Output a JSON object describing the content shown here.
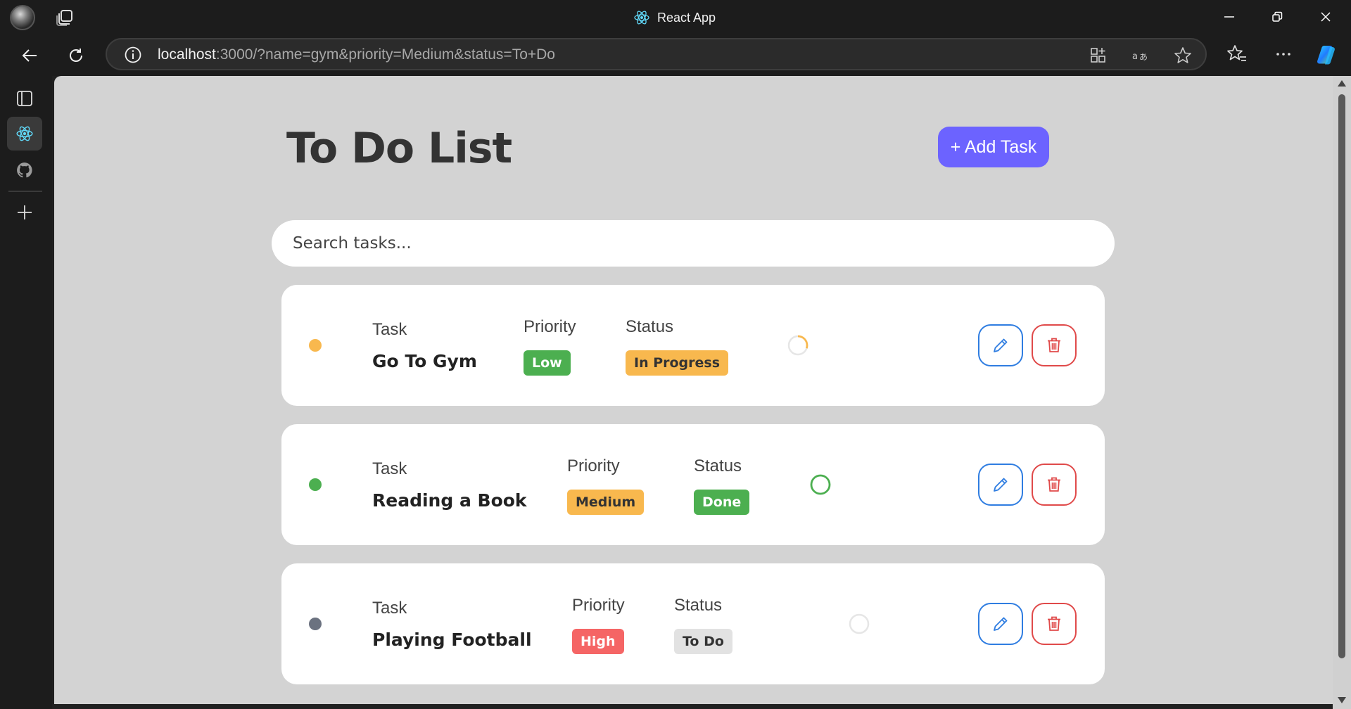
{
  "window": {
    "title": "React App"
  },
  "toolbar": {
    "url_host": "localhost",
    "url_rest": ":3000/?name=gym&priority=Medium&status=To+Do"
  },
  "app": {
    "title": "To Do List",
    "add_button": "+ Add Task",
    "search_placeholder": "Search tasks...",
    "column_labels": {
      "task": "Task",
      "priority": "Priority",
      "status": "Status"
    },
    "tasks": [
      {
        "name": "Go To Gym",
        "priority": "Low",
        "status": "In Progress",
        "dot_color": "#f8b84e",
        "priority_color": "#4caf50",
        "status_color": "#f8b84e",
        "progress_fraction": 0.3
      },
      {
        "name": "Reading a Book",
        "priority": "Medium",
        "status": "Done",
        "dot_color": "#4caf50",
        "priority_color": "#f8b84e",
        "status_color": "#4caf50",
        "progress_fraction": 1.0
      },
      {
        "name": "Playing Football",
        "priority": "High",
        "status": "To Do",
        "dot_color": "#6b7280",
        "priority_color": "#f56565",
        "status_color": "#e2e2e2",
        "progress_fraction": 0.0
      }
    ]
  },
  "colors": {
    "accent": "#6c63ff",
    "edit": "#2f7de1",
    "delete": "#e04a4a"
  },
  "icons": {
    "titlebar": [
      "profile-avatar",
      "tab-actions-icon",
      "react-icon",
      "minimize-icon",
      "restore-icon",
      "close-icon"
    ],
    "toolbar": [
      "back-icon",
      "refresh-icon",
      "info-icon",
      "app-available-icon",
      "read-aloud-icon",
      "favorite-star-icon",
      "favorites-icon",
      "more-icon",
      "copilot-icon"
    ],
    "sidebar": [
      "vertical-tabs-icon",
      "react-tab-icon",
      "github-tab-icon",
      "new-tab-icon"
    ]
  }
}
